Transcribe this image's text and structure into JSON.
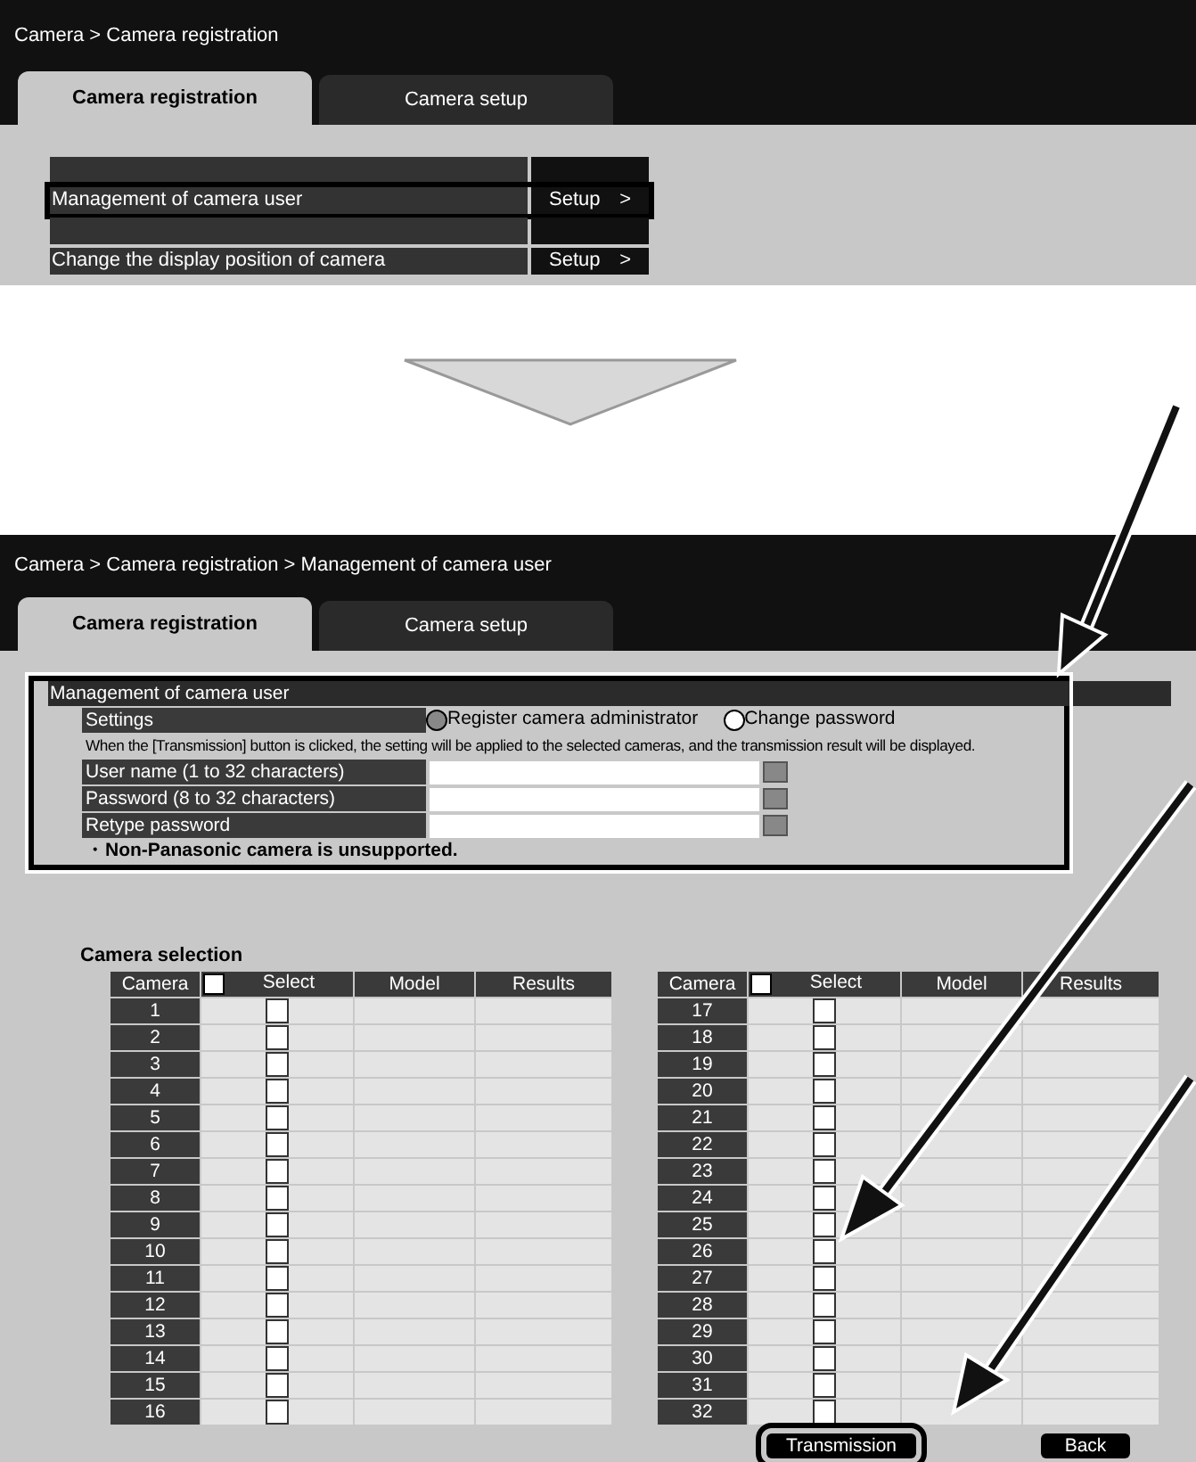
{
  "screen_1": {
    "breadcrumb": "Camera > Camera registration",
    "tabs": [
      {
        "label": "Camera registration",
        "selected": true
      },
      {
        "label": "Camera setup",
        "selected": false
      }
    ],
    "menu_rows": [
      {
        "kind": "obscured"
      },
      {
        "kind": "item",
        "label": "Management of camera user",
        "button": "Setup",
        "arrow": ">"
      },
      {
        "kind": "obscured"
      },
      {
        "kind": "item",
        "label": "Change the display position of camera",
        "button": "Setup",
        "arrow": ">"
      }
    ]
  },
  "screen_2": {
    "breadcrumb": "Camera > Camera registration > Management of camera user",
    "tabs": [
      {
        "label": "Camera registration",
        "selected": true
      },
      {
        "label": "Camera setup",
        "selected": false
      }
    ],
    "section_title": "Management of camera user",
    "settings_label": "Settings",
    "radios": [
      {
        "label": "Register camera administrator",
        "selected": true
      },
      {
        "label": "Change password",
        "selected": false
      }
    ],
    "notice": "When the [Transmission]  button is clicked, the setting will be applied to the selected cameras, and the transmission result will be displayed.",
    "fields": [
      {
        "label": "User name (1 to 32 characters)"
      },
      {
        "label": "Password (8 to 32 characters)"
      },
      {
        "label": "Retype password"
      }
    ],
    "footnote": "・Non-Panasonic camera is unsupported.",
    "selection_title": "Camera selection",
    "tables": [
      {
        "columns": [
          "Camera",
          "Select",
          "Model",
          "Results"
        ],
        "all_checked": false,
        "rows": [
          {
            "camera": "1",
            "checked": false
          },
          {
            "camera": "2",
            "checked": false
          },
          {
            "camera": "3",
            "checked": false
          },
          {
            "camera": "4",
            "checked": false
          },
          {
            "camera": "5",
            "checked": false
          },
          {
            "camera": "6",
            "checked": false
          },
          {
            "camera": "7",
            "checked": false
          },
          {
            "camera": "8",
            "checked": false
          },
          {
            "camera": "9",
            "checked": false
          },
          {
            "camera": "10",
            "checked": false
          },
          {
            "camera": "11",
            "checked": false
          },
          {
            "camera": "12",
            "checked": false
          },
          {
            "camera": "13",
            "checked": false
          },
          {
            "camera": "14",
            "checked": false
          },
          {
            "camera": "15",
            "checked": false
          },
          {
            "camera": "16",
            "checked": false
          }
        ]
      },
      {
        "columns": [
          "Camera",
          "Select",
          "Model",
          "Results"
        ],
        "all_checked": false,
        "rows": [
          {
            "camera": "17",
            "checked": false
          },
          {
            "camera": "18",
            "checked": false
          },
          {
            "camera": "19",
            "checked": false
          },
          {
            "camera": "20",
            "checked": false
          },
          {
            "camera": "21",
            "checked": false
          },
          {
            "camera": "22",
            "checked": false
          },
          {
            "camera": "23",
            "checked": false
          },
          {
            "camera": "24",
            "checked": false
          },
          {
            "camera": "25",
            "checked": false
          },
          {
            "camera": "26",
            "checked": false
          },
          {
            "camera": "27",
            "checked": false
          },
          {
            "camera": "28",
            "checked": false
          },
          {
            "camera": "29",
            "checked": false
          },
          {
            "camera": "30",
            "checked": false
          },
          {
            "camera": "31",
            "checked": false
          },
          {
            "camera": "32",
            "checked": false
          }
        ]
      }
    ],
    "buttons": [
      {
        "kind": "transmission",
        "label": "Transmission"
      },
      {
        "kind": "back",
        "label": "Back"
      }
    ]
  }
}
